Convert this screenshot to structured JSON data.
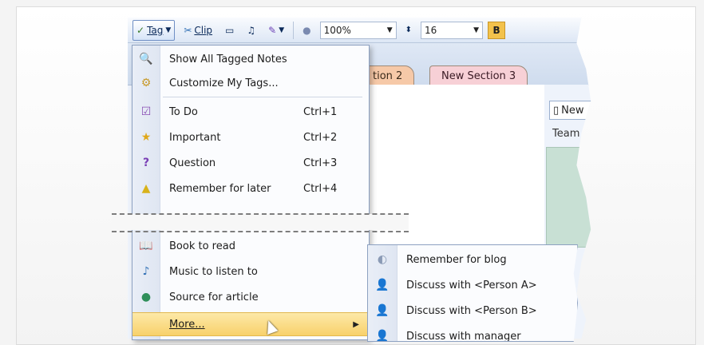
{
  "toolbar": {
    "tag_label": "Tag",
    "clip_label": "Clip",
    "zoom_value": "100%",
    "font_size_value": "16",
    "bold_label": "B"
  },
  "section_tabs": [
    {
      "label": "tion 2"
    },
    {
      "label": "New Section 3"
    }
  ],
  "right_panel": {
    "new_page_label": "New",
    "team_label": "Team I"
  },
  "menu": {
    "items": [
      {
        "label": "Show All Tagged Notes",
        "icon": "tagged-notes-icon"
      },
      {
        "label": "Customize My Tags...",
        "icon": "customize-tags-icon"
      },
      {
        "label": "To Do",
        "shortcut": "Ctrl+1",
        "icon": "checkbox-icon"
      },
      {
        "label": "Important",
        "shortcut": "Ctrl+2",
        "icon": "star-icon"
      },
      {
        "label": "Question",
        "shortcut": "Ctrl+3",
        "icon": "question-icon"
      },
      {
        "label": "Remember for later",
        "shortcut": "Ctrl+4",
        "icon": "highlighter-icon"
      },
      {
        "label": "Book to read",
        "icon": "book-icon"
      },
      {
        "label": "Music to listen to",
        "icon": "music-note-icon"
      },
      {
        "label": "Source for article",
        "icon": "source-icon"
      },
      {
        "label": "More...",
        "icon": "more-icon"
      }
    ]
  },
  "submenu": {
    "items": [
      {
        "label": "Remember for blog",
        "icon": "blog-icon"
      },
      {
        "label": "Discuss with <Person A>",
        "icon": "person-icon"
      },
      {
        "label": "Discuss with <Person B>",
        "icon": "person-icon"
      },
      {
        "label": "Discuss with manager",
        "icon": "person-icon"
      }
    ]
  },
  "colors": {
    "menu_highlight": "#f8d16b",
    "tab_2": "#f6c9a8",
    "tab_3": "#f7d0d6",
    "page_list": "#c8e0d4"
  }
}
